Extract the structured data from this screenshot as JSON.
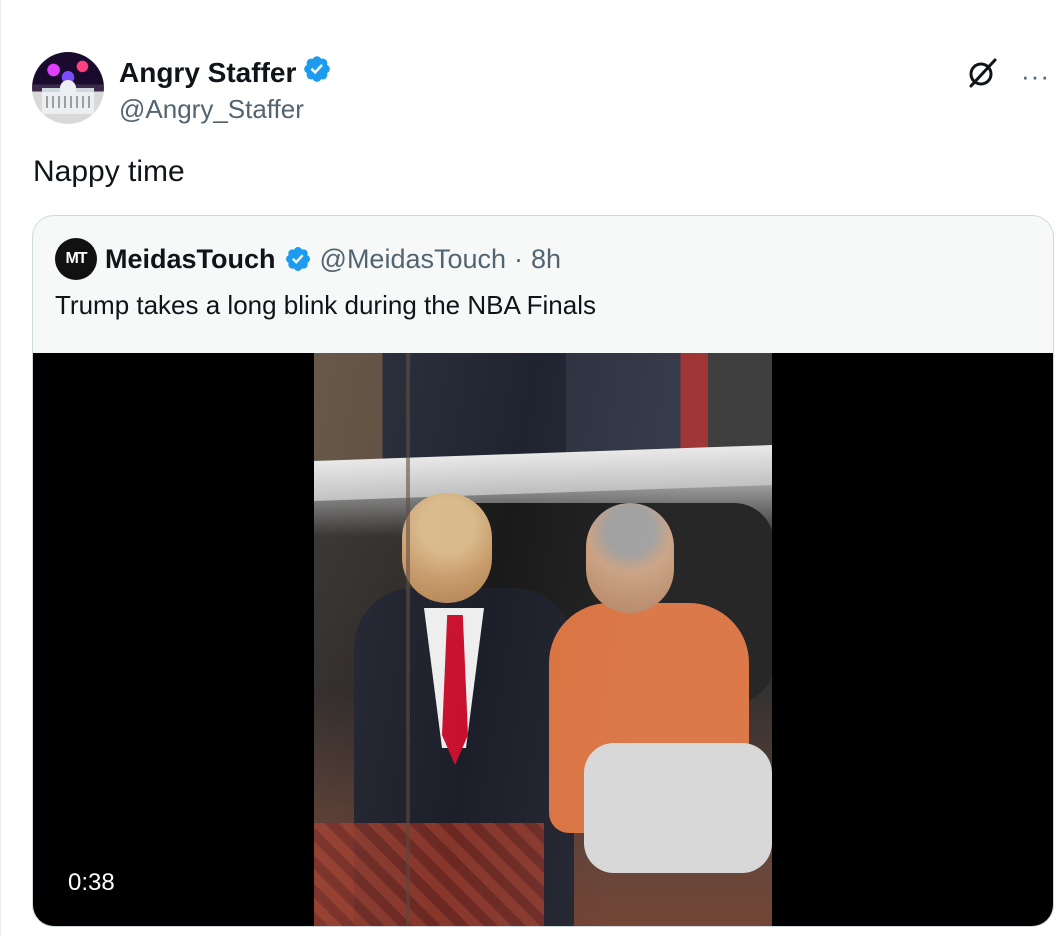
{
  "tweet": {
    "author_name": "Angry Staffer",
    "handle": "@Angry_Staffer",
    "text": "Nappy time",
    "more_label": "···"
  },
  "quote": {
    "avatar_text": "MT",
    "author_name": "MeidasTouch",
    "handle": "@MeidasTouch",
    "separator": "·",
    "time": "8h",
    "text": "Trump takes a long blink during the NBA Finals",
    "video_duration": "0:38"
  },
  "colors": {
    "verified": "#1d9bf0",
    "secondary_text": "#536471",
    "border": "#cfd9de"
  },
  "icons": [
    "verified-badge-icon",
    "grok-icon",
    "more-icon"
  ]
}
